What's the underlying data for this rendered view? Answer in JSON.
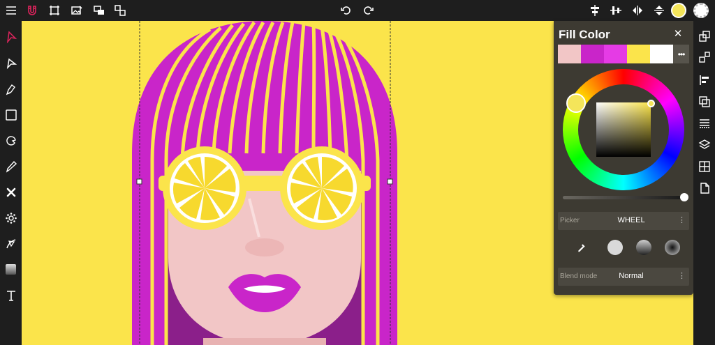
{
  "toolbar": {
    "menu_icon": "hamburger-menu-icon",
    "magnet_icon": "magnet-snap-icon",
    "colors": {
      "magnet": "#e0245e",
      "icon": "#ffffff",
      "selected_fill": "#f4e55a"
    }
  },
  "canvas": {
    "background": "#fbe44b"
  },
  "fill_panel": {
    "title": "Fill Color",
    "close_label": "✕",
    "swatches": [
      "#f2c6c6",
      "#c925c9",
      "#e53be5",
      "#fbe44b",
      "#ffffff"
    ],
    "more_label": "•••",
    "current_color": "#f4e55a",
    "picker_label": "Picker",
    "picker_value": "WHEEL",
    "picker_more": "⋮",
    "blend_label": "Blend mode",
    "blend_value": "Normal",
    "blend_more": "⋮"
  }
}
